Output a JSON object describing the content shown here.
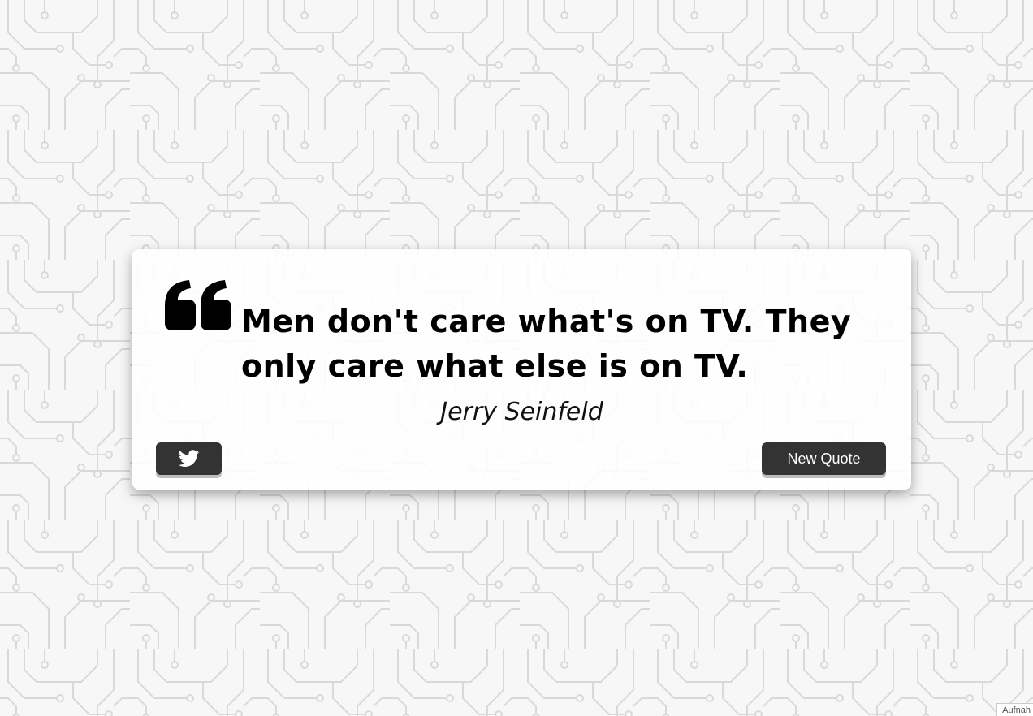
{
  "quote": {
    "text": "Men don't care what's on TV. They only care what else is on TV.",
    "author": "Jerry Seinfeld"
  },
  "buttons": {
    "tweet_icon": "twitter-icon",
    "new_quote_label": "New Quote"
  },
  "corner": {
    "label": "Aufnah"
  },
  "colors": {
    "button_bg": "#333333",
    "button_text": "#ffffff",
    "card_bg": "#ffffff",
    "pattern_stroke": "#d9d9d9",
    "page_bg": "#f7f7f7"
  }
}
